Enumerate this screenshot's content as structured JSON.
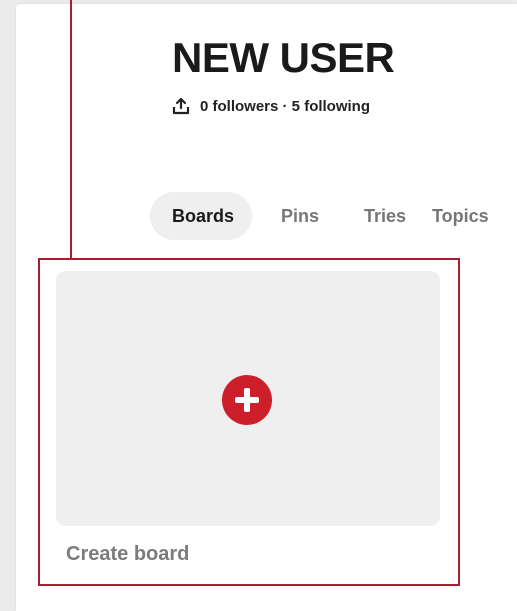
{
  "profile": {
    "name": "NEW USER",
    "stats": "0 followers · 5 following",
    "share_icon": "share-icon"
  },
  "tabs": [
    {
      "label": "Boards",
      "active": true
    },
    {
      "label": "Pins",
      "active": false
    },
    {
      "label": "Tries",
      "active": false
    },
    {
      "label": "Topics",
      "active": false
    }
  ],
  "create_board": {
    "label": "Create board",
    "icon": "plus-circle-icon"
  },
  "colors": {
    "accent": "#cc1f2a",
    "annotation": "#a8202b",
    "tile_background": "#efefef",
    "active_tab_background": "#efefef"
  }
}
